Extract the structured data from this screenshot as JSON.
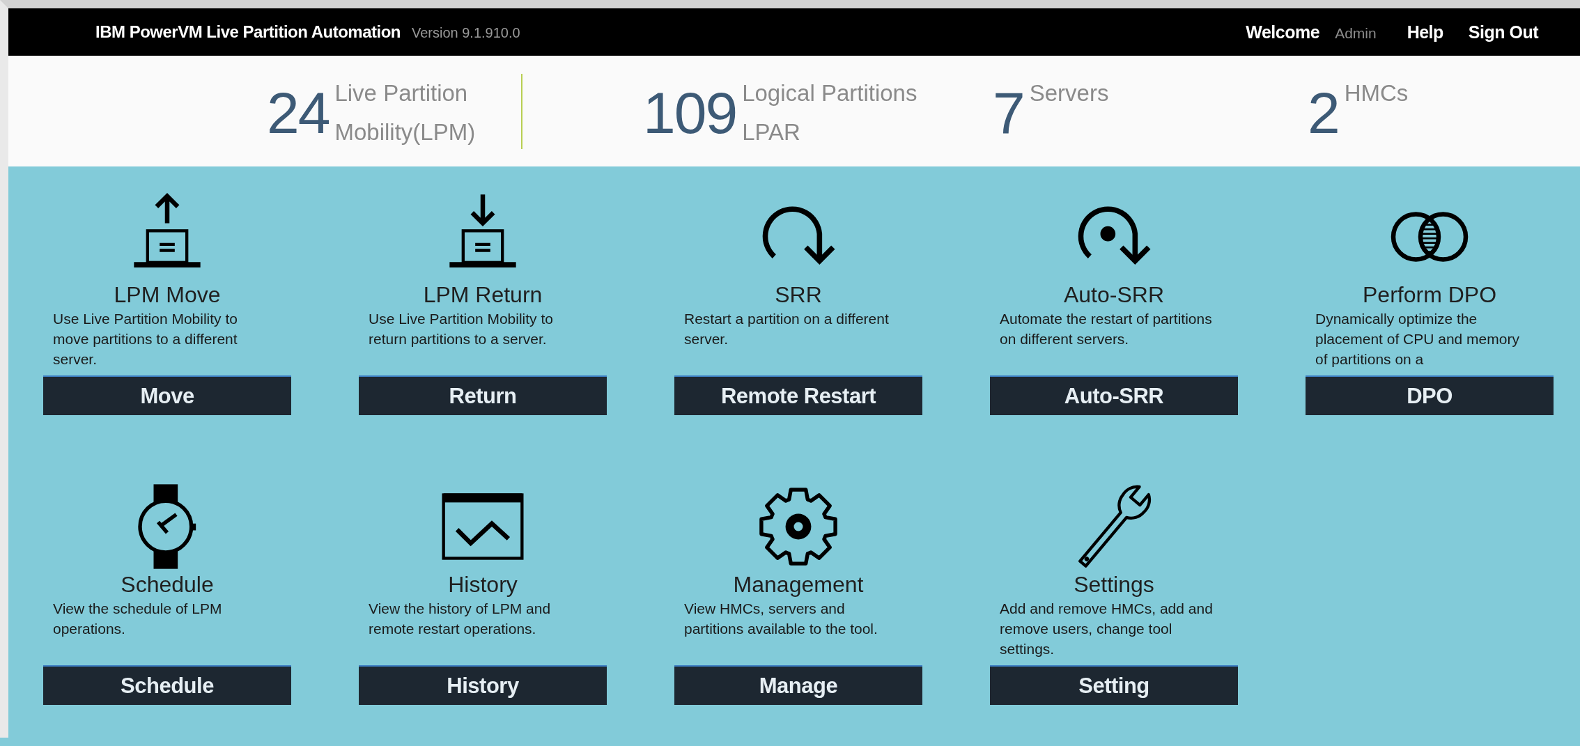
{
  "header": {
    "title": "IBM PowerVM Live Partition Automation",
    "version": "Version 9.1.910.0",
    "welcome": "Welcome",
    "user": "Admin",
    "links": [
      "Help",
      "Sign Out"
    ]
  },
  "stats": [
    {
      "value": "24",
      "label_lines": [
        "Live Partition",
        "Mobility(LPM)"
      ]
    },
    {
      "value": "109",
      "label_lines": [
        "Logical Partitions",
        "LPAR"
      ]
    },
    {
      "value": "7",
      "label_lines": [
        "Servers"
      ]
    },
    {
      "value": "2",
      "label_lines": [
        "HMCs"
      ]
    }
  ],
  "cards": [
    {
      "title": "LPM Move",
      "description": "Use Live Partition Mobility to move partitions to a different server.",
      "button": "Move"
    },
    {
      "title": "LPM Return",
      "description": "Use Live Partition Mobility to return partitions to a server.",
      "button": "Return"
    },
    {
      "title": "SRR",
      "description": "Restart a partition on a different server.",
      "button": "Remote Restart"
    },
    {
      "title": "Auto-SRR",
      "description": "Automate the restart of partitions on different servers.",
      "button": "Auto-SRR"
    },
    {
      "title": "Perform DPO",
      "description": "Dynamically optimize the placement of CPU and memory of partitions on a",
      "button": "DPO"
    },
    {
      "title": "Schedule",
      "description": "View the schedule of LPM operations.",
      "button": "Schedule"
    },
    {
      "title": "History",
      "description": "View the history of LPM and remote restart operations.",
      "button": "History"
    },
    {
      "title": "Management",
      "description": "View HMCs, servers and partitions available to the tool.",
      "button": "Manage"
    },
    {
      "title": "Settings",
      "description": "Add and remove HMCs, add and remove users, change tool settings.",
      "button": "Setting"
    }
  ]
}
